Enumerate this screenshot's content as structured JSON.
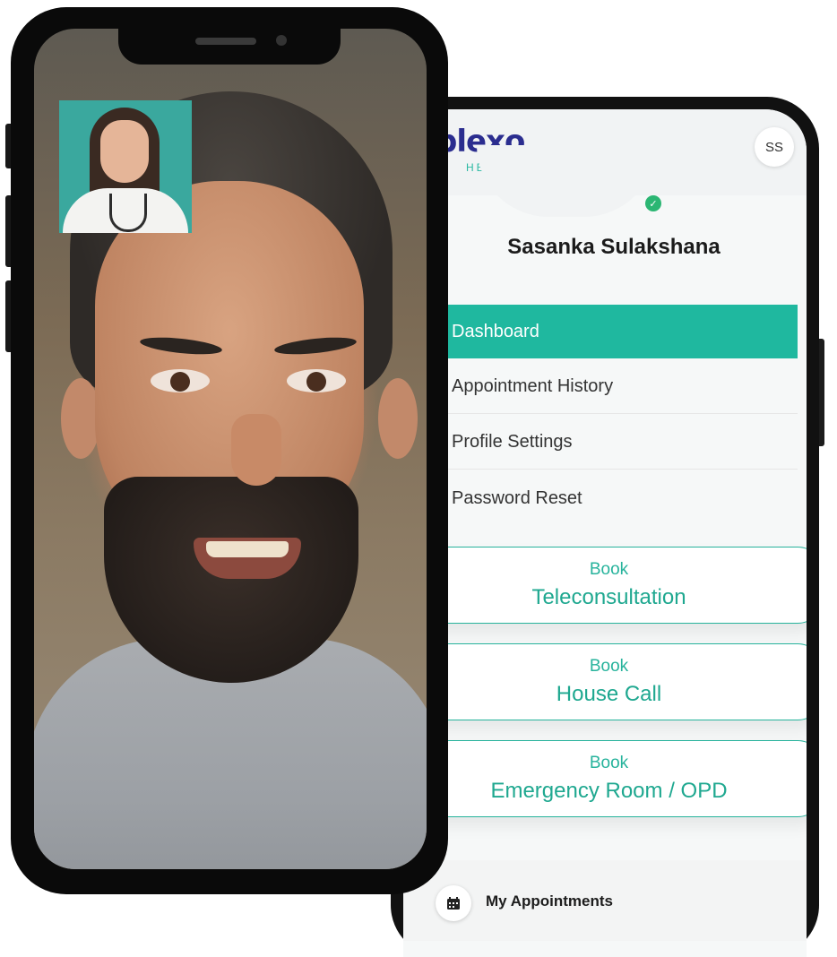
{
  "app": {
    "logo_text": "plexo",
    "logo_sub": "HEALTH",
    "avatar_initials": "SS",
    "user_name": "Sasanka Sulakshana"
  },
  "menu": {
    "items": [
      {
        "label": "Dashboard",
        "active": true
      },
      {
        "label": "Appointment History",
        "active": false
      },
      {
        "label": "Profile Settings",
        "active": false
      },
      {
        "label": "Password Reset",
        "active": false
      }
    ]
  },
  "booking": {
    "cards": [
      {
        "prefix": "Book",
        "title": "Teleconsultation"
      },
      {
        "prefix": "Book",
        "title": "House Call"
      },
      {
        "prefix": "Book",
        "title": "Emergency Room / OPD"
      }
    ]
  },
  "bottom": {
    "label": "My Appointments",
    "icon": "calendar-icon"
  },
  "colors": {
    "accent": "#1fb89f",
    "brand_navy": "#2b2d8f",
    "online": "#2bb673"
  },
  "video_call": {
    "self_view": "doctor-pip",
    "main_view": "patient-video"
  }
}
